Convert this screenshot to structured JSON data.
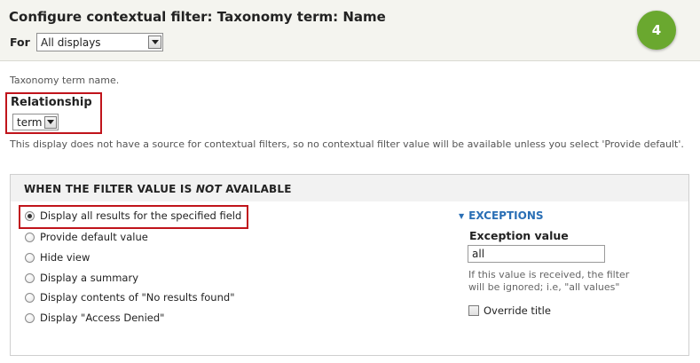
{
  "header": {
    "title": "Configure contextual filter: Taxonomy term: Name",
    "for_label": "For",
    "for_select_value": "All displays",
    "step_badge": "4"
  },
  "description": "Taxonomy term name.",
  "relationship": {
    "label": "Relationship",
    "select_value": "term"
  },
  "warning": "This display does not have a source for contextual filters, so no contextual filter value will be available unless you select 'Provide default'.",
  "filter_section": {
    "legend_prefix": "WHEN THE FILTER VALUE IS ",
    "legend_emphasis": "NOT",
    "legend_suffix": " AVAILABLE",
    "options": [
      {
        "label": "Display all results for the specified field",
        "checked": true
      },
      {
        "label": "Provide default value",
        "checked": false
      },
      {
        "label": "Hide view",
        "checked": false
      },
      {
        "label": "Display a summary",
        "checked": false
      },
      {
        "label": "Display contents of \"No results found\"",
        "checked": false
      },
      {
        "label": "Display \"Access Denied\"",
        "checked": false
      }
    ]
  },
  "exceptions": {
    "heading": "EXCEPTIONS",
    "exception_label": "Exception value",
    "exception_value": "all",
    "help": "If this value is received, the filter will be ignored; i.e, \"all values\"",
    "override_title_label": "Override title",
    "override_title_checked": false
  },
  "colors": {
    "highlight": "#c0141b",
    "badge": "#6aa82f",
    "link": "#2a6fb5"
  }
}
